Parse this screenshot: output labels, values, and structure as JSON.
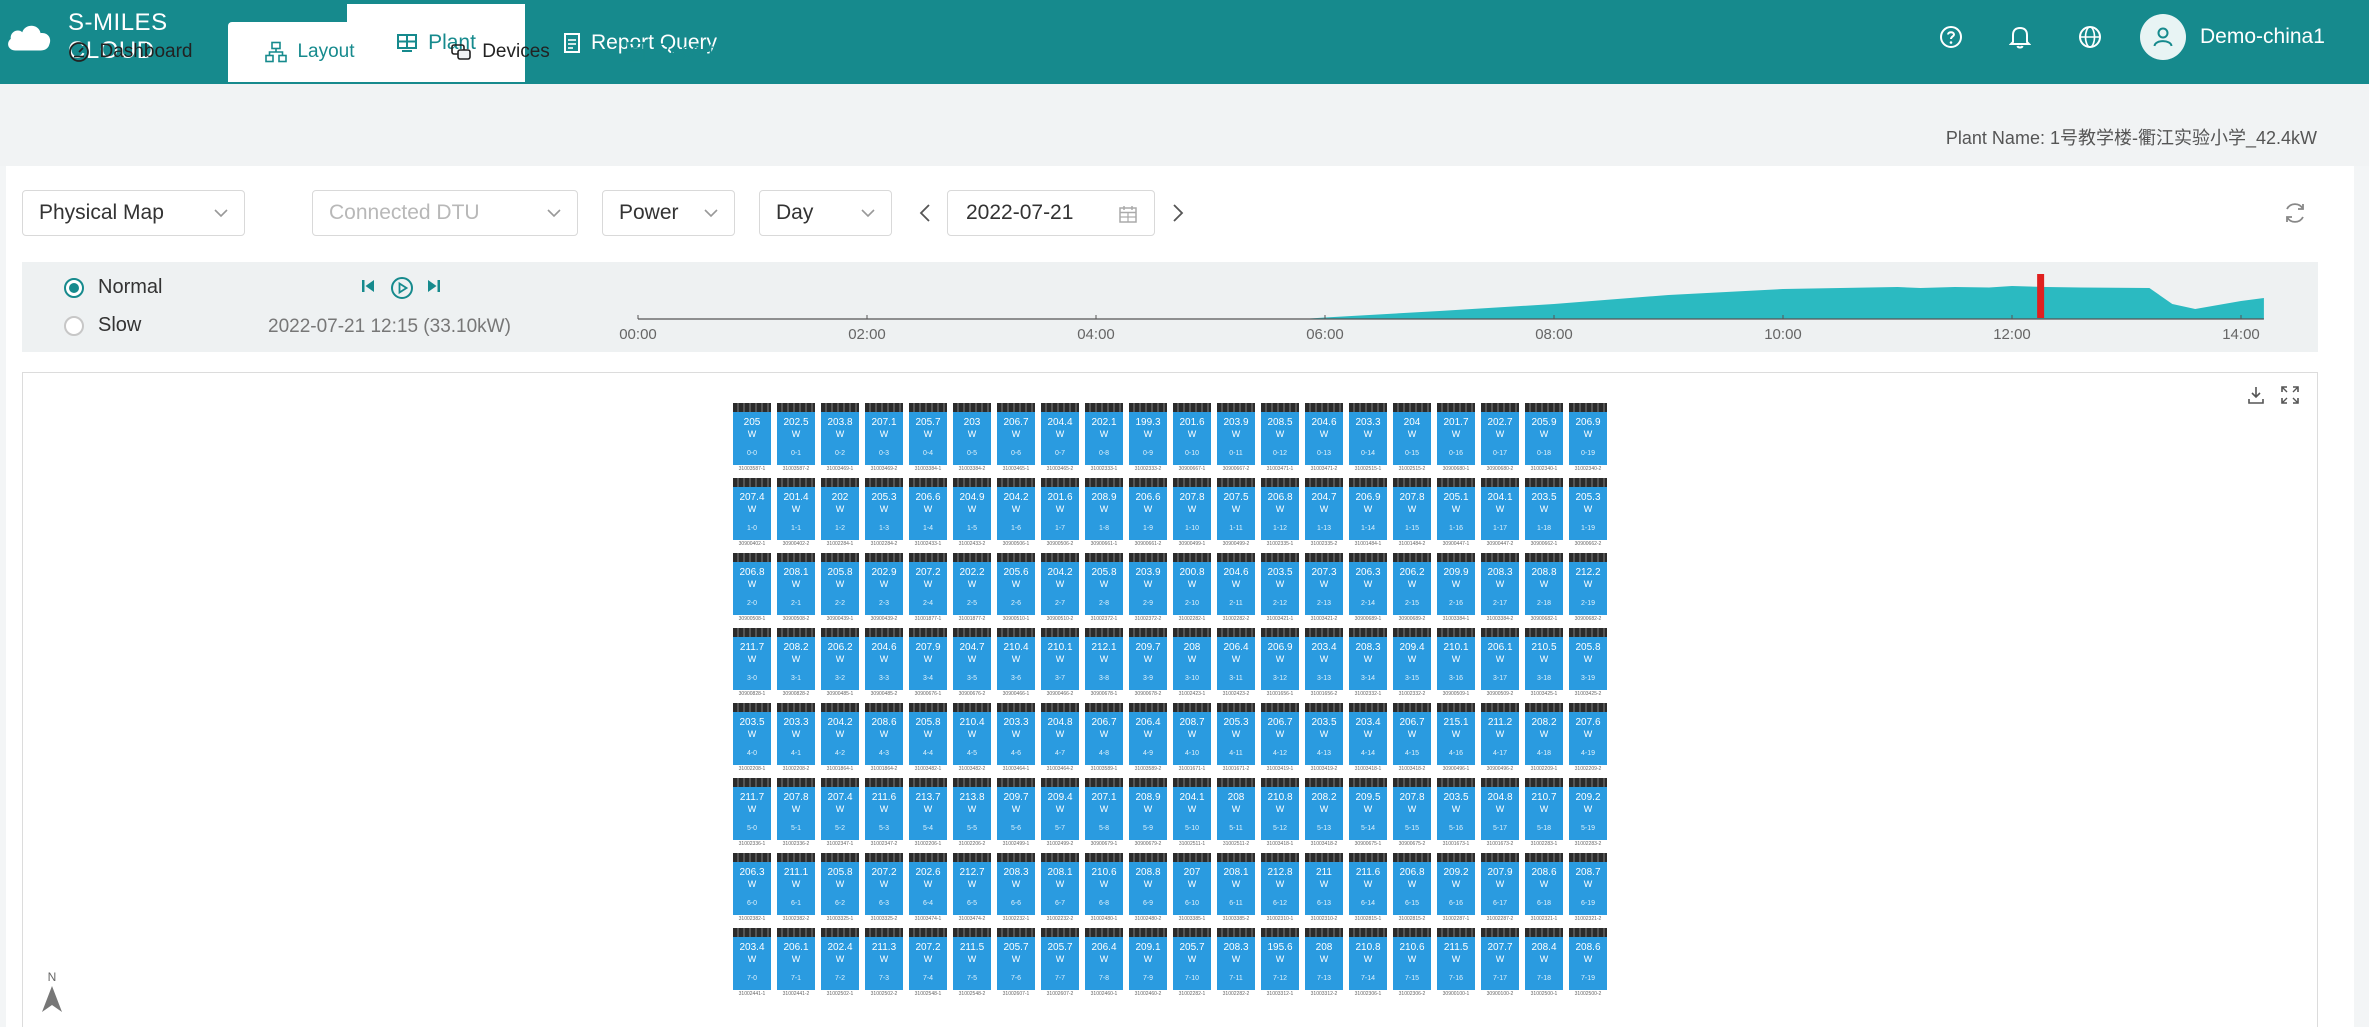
{
  "brand": {
    "name": "S-MILES CLOUD"
  },
  "nav": {
    "tabs": [
      {
        "label": "Plant"
      },
      {
        "label": "Report Query"
      }
    ]
  },
  "user": {
    "name": "Demo-china1"
  },
  "subtabs": [
    {
      "label": "Dashboard"
    },
    {
      "label": "Layout"
    },
    {
      "label": "Devices"
    },
    {
      "label": "Report"
    }
  ],
  "plant": {
    "label": "Plant Name: 1号教学楼-衢江实验小学_42.4kW"
  },
  "filters": {
    "map_type": "Physical Map",
    "dtu_placeholder": "Connected DTU",
    "metric": "Power",
    "period": "Day",
    "date": "2022-07-21"
  },
  "playback": {
    "speed_options": [
      {
        "label": "Normal",
        "selected": true
      },
      {
        "label": "Slow",
        "selected": false
      }
    ],
    "current": "2022-07-21 12:15 (33.10kW)",
    "ticks": [
      "00:00",
      "02:00",
      "04:00",
      "06:00",
      "08:00",
      "10:00",
      "12:00",
      "14:00"
    ],
    "marker_time": "12:15",
    "curve_hours": [
      0,
      5.8,
      6,
      7,
      8,
      9,
      10,
      11,
      11.2,
      11.5,
      11.8,
      12,
      12.3,
      12.6,
      13.2,
      13.4,
      13.6,
      14,
      14.2
    ],
    "curve_kw": [
      0,
      0,
      1.5,
      8,
      15,
      24,
      30,
      32,
      31,
      32,
      31.5,
      33,
      32,
      31.5,
      31,
      15,
      10,
      18,
      21
    ],
    "curve_color": "#2bbac1",
    "marker_color": "#e0201f"
  },
  "layout": {
    "north_label": "N",
    "panel_color": "#2a9be0",
    "unit": "W",
    "rows": [
      {
        "values": [
          "205",
          "202.5",
          "203.8",
          "207.1",
          "205.7",
          "203",
          "206.7",
          "204.4",
          "202.1",
          "199.3",
          "201.6",
          "203.9",
          "208.5",
          "204.6",
          "203.3",
          "204",
          "201.7",
          "202.7",
          "205.9",
          "206.9"
        ],
        "ids": [
          "0-0",
          "0-1",
          "0-2",
          "0-3",
          "0-4",
          "0-5",
          "0-6",
          "0-7",
          "0-8",
          "0-9",
          "0-10",
          "0-11",
          "0-12",
          "0-13",
          "0-14",
          "0-15",
          "0-16",
          "0-17",
          "0-18",
          "0-19"
        ],
        "sns": [
          "31003587-1",
          "31003587-2",
          "31003469-1",
          "31003469-2",
          "31003384-1",
          "31003384-2",
          "31003465-1",
          "31003465-2",
          "31002333-1",
          "31002333-2",
          "30900667-1",
          "30900667-2",
          "31003471-1",
          "31003471-2",
          "31002515-1",
          "31002515-2",
          "30900680-1",
          "30900680-2",
          "31002340-1",
          "31002340-2"
        ]
      },
      {
        "values": [
          "207.4",
          "201.4",
          "202",
          "205.3",
          "206.6",
          "204.9",
          "204.2",
          "201.6",
          "208.9",
          "206.6",
          "207.8",
          "207.5",
          "206.8",
          "204.7",
          "206.9",
          "207.8",
          "205.1",
          "204.1",
          "203.5",
          "205.3"
        ],
        "ids": [
          "1-0",
          "1-1",
          "1-2",
          "1-3",
          "1-4",
          "1-5",
          "1-6",
          "1-7",
          "1-8",
          "1-9",
          "1-10",
          "1-11",
          "1-12",
          "1-13",
          "1-14",
          "1-15",
          "1-16",
          "1-17",
          "1-18",
          "1-19"
        ],
        "sns": [
          "30900402-1",
          "30900402-2",
          "31002284-1",
          "31002284-2",
          "31002433-1",
          "31002433-2",
          "30900506-1",
          "30900506-2",
          "30900661-1",
          "30900661-2",
          "30900499-1",
          "30900499-2",
          "31002335-1",
          "31002335-2",
          "31001484-1",
          "31001484-2",
          "30900447-1",
          "30900447-2",
          "30900662-1",
          "30900662-2"
        ]
      },
      {
        "values": [
          "206.8",
          "208.1",
          "205.8",
          "202.9",
          "207.2",
          "202.2",
          "205.6",
          "204.2",
          "205.8",
          "203.9",
          "200.8",
          "204.6",
          "203.5",
          "207.3",
          "206.3",
          "206.2",
          "209.9",
          "208.3",
          "208.8",
          "212.2"
        ],
        "ids": [
          "2-0",
          "2-1",
          "2-2",
          "2-3",
          "2-4",
          "2-5",
          "2-6",
          "2-7",
          "2-8",
          "2-9",
          "2-10",
          "2-11",
          "2-12",
          "2-13",
          "2-14",
          "2-15",
          "2-16",
          "2-17",
          "2-18",
          "2-19"
        ],
        "sns": [
          "30900508-1",
          "30900508-2",
          "30900439-1",
          "30900439-2",
          "31001877-1",
          "31001877-2",
          "30900510-1",
          "30900510-2",
          "31002372-1",
          "31002372-2",
          "31002282-1",
          "31002282-2",
          "31003421-1",
          "31003421-2",
          "30900689-1",
          "30900689-2",
          "31003384-1",
          "31003384-2",
          "30900682-1",
          "30900682-2"
        ]
      },
      {
        "values": [
          "211.7",
          "208.2",
          "206.2",
          "204.6",
          "207.9",
          "204.7",
          "210.4",
          "210.1",
          "212.1",
          "209.7",
          "208",
          "206.4",
          "206.9",
          "203.4",
          "208.3",
          "209.4",
          "210.1",
          "206.1",
          "210.5",
          "205.8"
        ],
        "ids": [
          "3-0",
          "3-1",
          "3-2",
          "3-3",
          "3-4",
          "3-5",
          "3-6",
          "3-7",
          "3-8",
          "3-9",
          "3-10",
          "3-11",
          "3-12",
          "3-13",
          "3-14",
          "3-15",
          "3-16",
          "3-17",
          "3-18",
          "3-19"
        ],
        "sns": [
          "30900828-1",
          "30900828-2",
          "30900485-1",
          "30900485-2",
          "30900676-1",
          "30900676-2",
          "30900466-1",
          "30900466-2",
          "30900678-1",
          "30900678-2",
          "31002423-1",
          "31002423-2",
          "31001656-1",
          "31001656-2",
          "31002332-1",
          "31002332-2",
          "30900509-1",
          "30900509-2",
          "31003425-1",
          "31003425-2"
        ]
      },
      {
        "values": [
          "203.5",
          "203.3",
          "204.2",
          "208.6",
          "205.8",
          "210.4",
          "203.3",
          "204.8",
          "206.7",
          "206.4",
          "208.7",
          "205.3",
          "206.7",
          "203.5",
          "203.4",
          "206.7",
          "215.1",
          "211.2",
          "208.2",
          "207.6"
        ],
        "ids": [
          "4-0",
          "4-1",
          "4-2",
          "4-3",
          "4-4",
          "4-5",
          "4-6",
          "4-7",
          "4-8",
          "4-9",
          "4-10",
          "4-11",
          "4-12",
          "4-13",
          "4-14",
          "4-15",
          "4-16",
          "4-17",
          "4-18",
          "4-19"
        ],
        "sns": [
          "31002208-1",
          "31002208-2",
          "31001864-1",
          "31001864-2",
          "31003482-1",
          "31003482-2",
          "31003464-1",
          "31003464-2",
          "31003589-1",
          "31003589-2",
          "31001671-1",
          "31001671-2",
          "31003419-1",
          "31003419-2",
          "31003418-1",
          "31003418-2",
          "30900496-1",
          "30900496-2",
          "31002209-1",
          "31002209-2"
        ]
      },
      {
        "values": [
          "211.7",
          "207.8",
          "207.4",
          "211.6",
          "213.7",
          "213.8",
          "209.7",
          "209.4",
          "207.1",
          "208.9",
          "204.1",
          "208",
          "210.8",
          "208.2",
          "209.5",
          "207.8",
          "203.5",
          "204.8",
          "210.7",
          "209.2"
        ],
        "ids": [
          "5-0",
          "5-1",
          "5-2",
          "5-3",
          "5-4",
          "5-5",
          "5-6",
          "5-7",
          "5-8",
          "5-9",
          "5-10",
          "5-11",
          "5-12",
          "5-13",
          "5-14",
          "5-15",
          "5-16",
          "5-17",
          "5-18",
          "5-19"
        ],
        "sns": [
          "31002336-1",
          "31002336-2",
          "31002347-1",
          "31002347-2",
          "31002206-1",
          "31002206-2",
          "31002499-1",
          "31002499-2",
          "30900679-1",
          "30900679-2",
          "31002511-1",
          "31002511-2",
          "31003418-1",
          "31003418-2",
          "30900675-1",
          "30900675-2",
          "31001673-1",
          "31001673-2",
          "31002283-1",
          "31002283-2"
        ]
      },
      {
        "values": [
          "206.3",
          "211.1",
          "205.8",
          "207.2",
          "202.6",
          "212.7",
          "208.3",
          "208.1",
          "210.6",
          "208.8",
          "207",
          "208.1",
          "212.8",
          "211",
          "211.6",
          "206.8",
          "209.2",
          "207.9",
          "208.6",
          "208.7"
        ],
        "ids": [
          "6-0",
          "6-1",
          "6-2",
          "6-3",
          "6-4",
          "6-5",
          "6-6",
          "6-7",
          "6-8",
          "6-9",
          "6-10",
          "6-11",
          "6-12",
          "6-13",
          "6-14",
          "6-15",
          "6-16",
          "6-17",
          "6-18",
          "6-19"
        ],
        "sns": [
          "31002382-1",
          "31002382-2",
          "31003325-1",
          "31003325-2",
          "31003474-1",
          "31003474-2",
          "31002232-1",
          "31002232-2",
          "31002480-1",
          "31002480-2",
          "31003385-1",
          "31003385-2",
          "31002310-1",
          "31002310-2",
          "31002815-1",
          "31002815-2",
          "31002287-1",
          "31002287-2",
          "31002321-1",
          "31002321-2"
        ]
      },
      {
        "values": [
          "203.4",
          "206.1",
          "202.4",
          "211.3",
          "207.2",
          "211.5",
          "205.7",
          "205.7",
          "206.4",
          "209.1",
          "205.7",
          "208.3",
          "195.6",
          "208",
          "210.8",
          "210.6",
          "211.5",
          "207.7",
          "208.4",
          "208.6"
        ],
        "ids": [
          "7-0",
          "7-1",
          "7-2",
          "7-3",
          "7-4",
          "7-5",
          "7-6",
          "7-7",
          "7-8",
          "7-9",
          "7-10",
          "7-11",
          "7-12",
          "7-13",
          "7-14",
          "7-15",
          "7-16",
          "7-17",
          "7-18",
          "7-19"
        ],
        "sns": [
          "31002441-1",
          "31002441-2",
          "31002502-1",
          "31002502-2",
          "31002548-1",
          "31002548-2",
          "31002607-1",
          "31002607-2",
          "31002460-1",
          "31002460-2",
          "31002282-1",
          "31002282-2",
          "31003312-1",
          "31003312-2",
          "31002306-1",
          "31002306-2",
          "30900100-1",
          "30900100-2",
          "31002500-1",
          "31002500-2"
        ]
      }
    ]
  }
}
